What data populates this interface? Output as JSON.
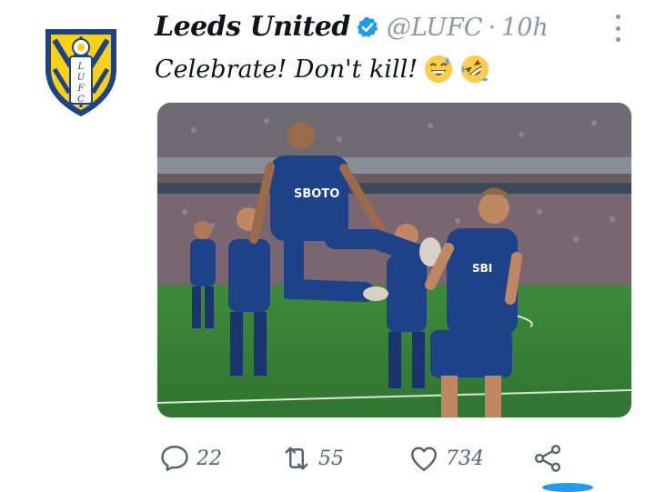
{
  "tweet": {
    "display_name": "Leeds United",
    "handle": "@LUFC",
    "separator": "·",
    "time": "10h",
    "text": "Celebrate! Don't kill!",
    "emojis": [
      "grinning-sweat-emoji",
      "rolling-laughing-emoji"
    ],
    "avatar_crest_letters": "LUFC",
    "media_alt_badges": [
      "SBOTOP"
    ],
    "verified_color": "#1d9bf0"
  },
  "actions": {
    "replies": "22",
    "retweets": "55",
    "likes": "734",
    "icons": [
      "reply-icon",
      "retweet-icon",
      "like-icon",
      "share-icon"
    ]
  },
  "colors": {
    "accent": "#1d9bf0",
    "muted": "#8a96a3",
    "leeds_yellow": "#f7d117",
    "leeds_blue": "#1d428a"
  }
}
